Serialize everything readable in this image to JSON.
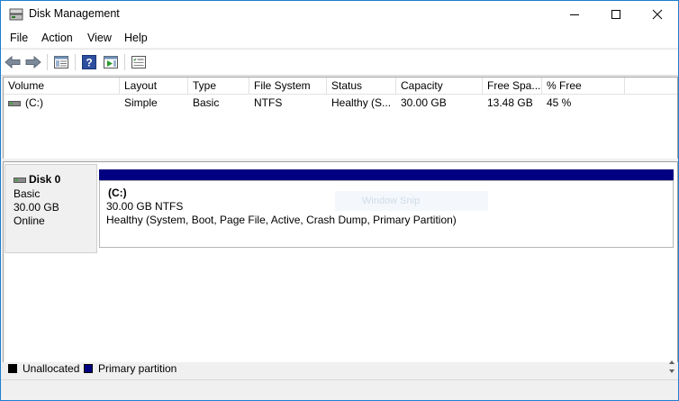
{
  "window": {
    "title": "Disk Management"
  },
  "menu": [
    "File",
    "Action",
    "View",
    "Help"
  ],
  "toolbar": {
    "icons": [
      "back-arrow-icon",
      "forward-arrow-icon",
      "show-hide-console-tree-icon",
      "help-icon",
      "show-action-pane-icon",
      "properties-icon"
    ]
  },
  "volume_table": {
    "columns": [
      "Volume",
      "Layout",
      "Type",
      "File System",
      "Status",
      "Capacity",
      "Free Spa...",
      "% Free"
    ],
    "rows": [
      {
        "volume": "(C:)",
        "layout": "Simple",
        "type": "Basic",
        "file_system": "NTFS",
        "status": "Healthy (S...",
        "capacity": "30.00 GB",
        "free_space": "13.48 GB",
        "pct_free": "45 %"
      }
    ]
  },
  "disk": {
    "name": "Disk 0",
    "type": "Basic",
    "size": "30.00 GB",
    "state": "Online",
    "partition": {
      "label": "(C:)",
      "size_fs": "30.00 GB NTFS",
      "status": "Healthy (System, Boot, Page File, Active, Crash Dump, Primary Partition)"
    }
  },
  "overlay": {
    "text": "Window Snip"
  },
  "legend": [
    {
      "label": "Unallocated",
      "color": "#000000"
    },
    {
      "label": "Primary partition",
      "color": "#000080"
    }
  ],
  "colors": {
    "primary_partition": "#000080",
    "accent": "#1c7fd0"
  }
}
